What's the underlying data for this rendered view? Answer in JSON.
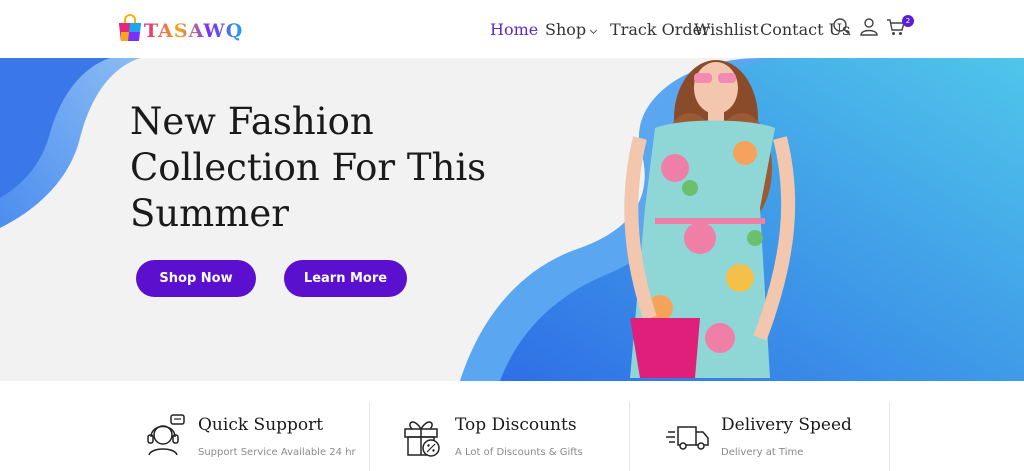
{
  "brand": {
    "name": "TASAWQ"
  },
  "nav": {
    "items": [
      {
        "label": "Home",
        "active": true
      },
      {
        "label": "Shop",
        "dropdown": true
      },
      {
        "label": "Track Order"
      },
      {
        "label": "Wishlist"
      },
      {
        "label": "Contact Us"
      }
    ]
  },
  "header_icons": [
    "search-icon",
    "user-icon",
    "cart-icon"
  ],
  "cart": {
    "count": "2"
  },
  "hero": {
    "title": "New Fashion Collection For This Summer",
    "buttons": {
      "shop_now": "Shop Now",
      "learn_more": "Learn More"
    }
  },
  "features": [
    {
      "icon": "support-agent-icon",
      "title": "Quick Support",
      "subtitle": "Support Service Available 24 hr"
    },
    {
      "icon": "gift-discount-icon",
      "title": "Top Discounts",
      "subtitle": "A Lot of Discounts & Gifts"
    },
    {
      "icon": "delivery-truck-icon",
      "title": "Delivery Speed",
      "subtitle": "Delivery at Time"
    }
  ],
  "colors": {
    "accent": "#5b0fcf",
    "nav_active": "#5a2ad6",
    "hero_blue": "#2f6fe6",
    "hero_cyan": "#4fc6ea"
  }
}
